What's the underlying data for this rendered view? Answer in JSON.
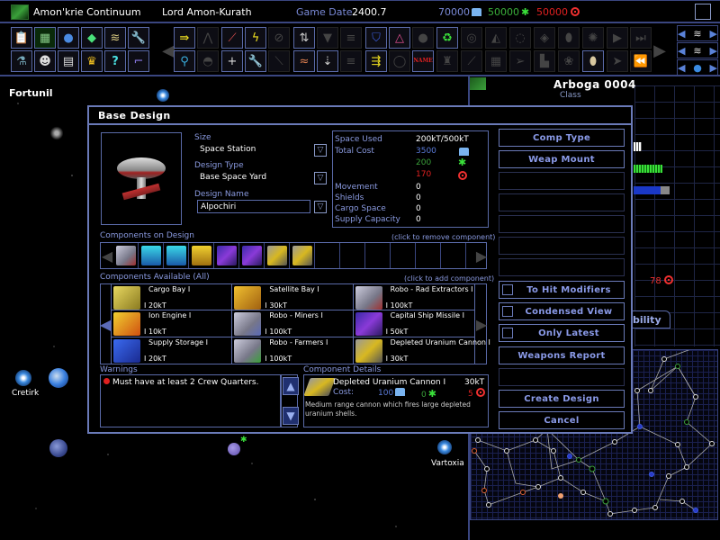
{
  "topbar": {
    "empire": "Amon'krie Continuum",
    "leader": "Lord Amon-Kurath",
    "game_date_label": "Game Date",
    "game_date": "2400.7",
    "resources": {
      "minerals": "70000",
      "organics": "50000",
      "radioactives": "50000"
    }
  },
  "toolbar": {
    "left_row1": [
      "clipboard-icon",
      "circuit-board-icon",
      "globe-icon",
      "gem-icon",
      "ships-icon",
      "wrench-icon"
    ],
    "left_row2": [
      "flask-icon",
      "alien-icon",
      "notepad-icon",
      "crown-icon",
      "help-icon",
      "pipe-icon"
    ],
    "name_button": "NAME"
  },
  "map": {
    "systems": [
      {
        "name": "Fortunil"
      },
      {
        "name": "Cretirk"
      },
      {
        "name": "Vartoxia"
      }
    ]
  },
  "ship_panel": {
    "name": "Arboga 0004",
    "class_label": "Class",
    "stat_value": "78",
    "tab_label": "bility"
  },
  "dialog": {
    "title": "Base Design",
    "size_label": "Size",
    "size_value": "Space Station",
    "type_label": "Design Type",
    "type_value": "Base Space Yard",
    "name_label": "Design Name",
    "name_value": "Alpochiri",
    "stats": {
      "space_used_label": "Space Used",
      "space_used": "200kT/500kT",
      "total_cost_label": "Total Cost",
      "cost_minerals": "3500",
      "cost_organics": "200",
      "cost_radioactives": "170",
      "movement_label": "Movement",
      "movement": "0",
      "shields_label": "Shields",
      "shields": "0",
      "cargo_label": "Cargo Space",
      "cargo": "0",
      "supply_label": "Supply Capacity",
      "supply": "0"
    },
    "on_design_label": "Components on Design",
    "on_design_hint": "(click to remove component)",
    "on_design": [
      "Robo - Rad Extractors I",
      "Satellite Bay I",
      "Satellite Bay I",
      "Cargo Bay I",
      "Capital Ship Missile I",
      "Capital Ship Missile I",
      "Depleted Uranium Cannon I",
      "Depleted Uranium Cannon I"
    ],
    "available_label": "Components Available (All)",
    "available_hint": "(click to add component)",
    "available": [
      {
        "name": "Cargo Bay I",
        "size": "20kT",
        "qty": "I"
      },
      {
        "name": "Satellite Bay I",
        "size": "30kT",
        "qty": "I"
      },
      {
        "name": "Robo - Rad Extractors I",
        "size": "100kT",
        "qty": "I"
      },
      {
        "name": "Ion Engine I",
        "size": "10kT",
        "qty": "I"
      },
      {
        "name": "Robo - Miners I",
        "size": "100kT",
        "qty": "I"
      },
      {
        "name": "Capital Ship Missile I",
        "size": "50kT",
        "qty": "I"
      },
      {
        "name": "Supply Storage I",
        "size": "20kT",
        "qty": "I"
      },
      {
        "name": "Robo - Farmers I",
        "size": "100kT",
        "qty": "I"
      },
      {
        "name": "Depleted Uranium Cannon I",
        "size": "30kT",
        "qty": "I"
      }
    ],
    "warnings_label": "Warnings",
    "warnings": [
      "Must have at least 2 Crew Quarters."
    ],
    "details_label": "Component Details",
    "details": {
      "name": "Depleted Uranium Cannon I",
      "size": "30kT",
      "cost_label": "Cost:",
      "cost_minerals": "100",
      "cost_organics": "0",
      "cost_radioactives": "5",
      "description": "Medium range cannon which fires large depleted uranium shells."
    },
    "buttons": {
      "comp_type": "Comp Type",
      "weap_mount": "Weap Mount",
      "to_hit": "To Hit Modifiers",
      "condensed": "Condensed View",
      "only_latest": "Only Latest",
      "weapons_report": "Weapons Report",
      "create": "Create Design",
      "cancel": "Cancel"
    }
  },
  "colors": {
    "accent": "#6a7ab8",
    "label": "#8a9ae0",
    "minerals": "#7ab4f0",
    "organics": "#3ae03a",
    "radioactives": "#f03030"
  }
}
